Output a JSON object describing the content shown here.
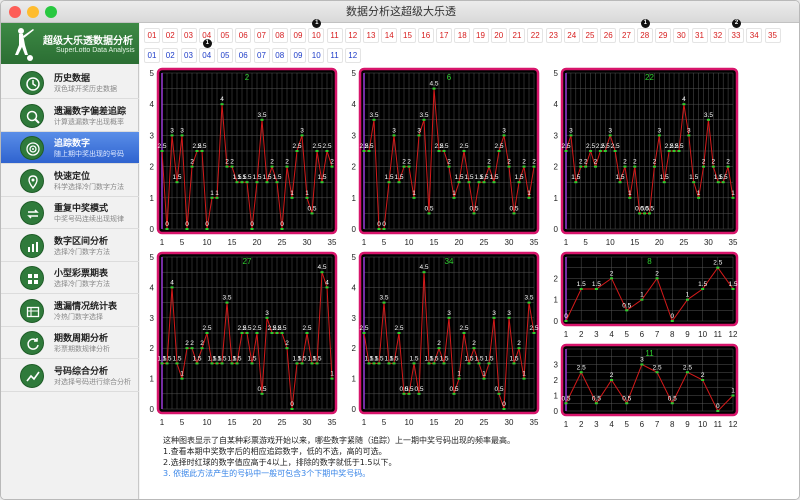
{
  "window": {
    "title": "数据分析这超级大乐透",
    "traffic_colors": [
      "#fd5d57",
      "#febc2e",
      "#28c840"
    ]
  },
  "logo": {
    "title": "超级大乐透数据分析",
    "subtitle": "SuperLotto Data Analysis"
  },
  "nav": [
    {
      "title": "历史数据",
      "subtitle": "双色球开奖历史数据",
      "icon": "clock-icon",
      "active": false
    },
    {
      "title": "遗漏数字偏差追踪",
      "subtitle": "计算遗漏数字出现概率",
      "icon": "magnifier-icon",
      "active": false
    },
    {
      "title": "追踪数字",
      "subtitle": "随上期中奖出现的号码",
      "icon": "target-icon",
      "active": true
    },
    {
      "title": "快速定位",
      "subtitle": "科学选择冷门数字方法",
      "icon": "pin-icon",
      "active": false
    },
    {
      "title": "重复中奖模式",
      "subtitle": "中奖号码连续出现规律",
      "icon": "repeat-icon",
      "active": false
    },
    {
      "title": "数字区间分析",
      "subtitle": "选择冷门数字方法",
      "icon": "chart-bars-icon",
      "active": false
    },
    {
      "title": "小型彩票期表",
      "subtitle": "选择冷门数字方法",
      "icon": "grid-icon",
      "active": false
    },
    {
      "title": "遗漏情况统计表",
      "subtitle": "冷热门数字选择",
      "icon": "table-icon",
      "active": false
    },
    {
      "title": "期数周期分析",
      "subtitle": "彩票期数规律分析",
      "icon": "cycle-icon",
      "active": false
    },
    {
      "title": "号码综合分析",
      "subtitle": "对选择号码进行综合分析",
      "icon": "analysis-icon",
      "active": false
    }
  ],
  "numbers": {
    "red": [
      "01",
      "02",
      "03",
      "04",
      "05",
      "06",
      "07",
      "08",
      "09",
      "10",
      "11",
      "12",
      "13",
      "14",
      "15",
      "16",
      "17",
      "18",
      "19",
      "20",
      "21",
      "22",
      "23",
      "24",
      "25",
      "26",
      "27",
      "28",
      "29",
      "30",
      "31",
      "32",
      "33",
      "34",
      "35"
    ],
    "blue": [
      "01",
      "02",
      "03",
      "04",
      "05",
      "06",
      "07",
      "08",
      "09",
      "10",
      "11",
      "12"
    ],
    "red_badges": [
      {
        "index": 9,
        "label": "1"
      },
      {
        "index": 27,
        "label": "1"
      },
      {
        "index": 32,
        "label": "2"
      }
    ],
    "blue_badges": [
      {
        "index": 3,
        "label": "1"
      }
    ]
  },
  "colors": {
    "chart_bg": "#000000",
    "chart_border": "#d7156b",
    "chart_line": "#d41a1a",
    "chart_label": "#ffffff",
    "chart_title": "#30d030",
    "chart_marker": "#30d030",
    "axis_text": "#222222",
    "red_ball": "#d61d1d",
    "blue_ball": "#1e3ec8"
  },
  "chart_data": [
    {
      "type": "line",
      "title": "2",
      "x": [
        1,
        2,
        3,
        4,
        5,
        6,
        7,
        8,
        9,
        10,
        11,
        12,
        13,
        14,
        15,
        16,
        17,
        18,
        19,
        20,
        21,
        22,
        23,
        24,
        25,
        26,
        27,
        28,
        29,
        30,
        31,
        32,
        33,
        34,
        35
      ],
      "values": [
        2.5,
        0,
        3,
        1.5,
        3,
        0,
        2,
        2.5,
        2.5,
        0,
        1,
        1,
        4,
        2,
        2,
        1.5,
        1.5,
        1.5,
        0,
        1.5,
        3.5,
        1.5,
        2,
        1.5,
        0,
        2,
        1,
        2.5,
        3,
        1,
        0.5,
        2.5,
        1.5,
        2.5,
        2
      ],
      "ylim": [
        0,
        5
      ],
      "xticks": [
        1,
        5,
        10,
        15,
        20,
        25,
        30,
        35
      ],
      "yticks": [
        0,
        1,
        2,
        3,
        4,
        5
      ]
    },
    {
      "type": "line",
      "title": "6",
      "x": [
        1,
        2,
        3,
        4,
        5,
        6,
        7,
        8,
        9,
        10,
        11,
        12,
        13,
        14,
        15,
        16,
        17,
        18,
        19,
        20,
        21,
        22,
        23,
        24,
        25,
        26,
        27,
        28,
        29,
        30,
        31,
        32,
        33,
        34,
        35
      ],
      "values": [
        2.5,
        2.5,
        3.5,
        0,
        0,
        1.5,
        3,
        1.5,
        2,
        2,
        1,
        3,
        3.5,
        0.5,
        4.5,
        2.5,
        2.5,
        2,
        1,
        1.5,
        2.5,
        1.5,
        0.5,
        1.5,
        1.5,
        2,
        1.5,
        2.5,
        3,
        2,
        0.5,
        1.5,
        2,
        1,
        2
      ],
      "ylim": [
        0,
        5
      ],
      "xticks": [
        1,
        5,
        10,
        15,
        20,
        25,
        30,
        35
      ],
      "yticks": [
        0,
        1,
        2,
        3,
        4,
        5
      ]
    },
    {
      "type": "line",
      "title": "22",
      "x": [
        1,
        2,
        3,
        4,
        5,
        6,
        7,
        8,
        9,
        10,
        11,
        12,
        13,
        14,
        15,
        16,
        17,
        18,
        19,
        20,
        21,
        22,
        23,
        24,
        25,
        26,
        27,
        28,
        29,
        30,
        31,
        32,
        33,
        34,
        35
      ],
      "values": [
        2.5,
        3,
        1.5,
        2,
        2,
        2.5,
        2,
        2.5,
        2.5,
        3,
        2.5,
        1.5,
        2,
        1,
        2,
        0.5,
        0.5,
        0.5,
        2,
        3,
        1.5,
        2.5,
        2.5,
        2.5,
        4,
        3,
        1.5,
        1,
        2,
        3.5,
        2,
        1.5,
        1.5,
        2,
        1
      ],
      "ylim": [
        0,
        5
      ],
      "xticks": [
        1,
        5,
        10,
        15,
        20,
        25,
        30,
        35
      ],
      "yticks": [
        0,
        1,
        2,
        3,
        4,
        5
      ]
    },
    {
      "type": "line",
      "title": "27",
      "x": [
        1,
        2,
        3,
        4,
        5,
        6,
        7,
        8,
        9,
        10,
        11,
        12,
        13,
        14,
        15,
        16,
        17,
        18,
        19,
        20,
        21,
        22,
        23,
        24,
        25,
        26,
        27,
        28,
        29,
        30,
        31,
        32,
        33,
        34,
        35
      ],
      "values": [
        1.5,
        1.5,
        4,
        1.5,
        1,
        2,
        2,
        1.5,
        2,
        2.5,
        1.5,
        1.5,
        1.5,
        3.5,
        1.5,
        1.5,
        2.5,
        2.5,
        1.5,
        2.5,
        0.5,
        3,
        2.5,
        2.5,
        2.5,
        2,
        0,
        1.5,
        1.5,
        2.5,
        1.5,
        1.5,
        4.5,
        4,
        1
      ],
      "ylim": [
        0,
        5
      ],
      "xticks": [
        1,
        5,
        10,
        15,
        20,
        25,
        30,
        35
      ],
      "yticks": [
        0,
        1,
        2,
        3,
        4,
        5
      ]
    },
    {
      "type": "line",
      "title": "34",
      "x": [
        1,
        2,
        3,
        4,
        5,
        6,
        7,
        8,
        9,
        10,
        11,
        12,
        13,
        14,
        15,
        16,
        17,
        18,
        19,
        20,
        21,
        22,
        23,
        24,
        25,
        26,
        27,
        28,
        29,
        30,
        31,
        32,
        33,
        34,
        35
      ],
      "values": [
        2.5,
        1.5,
        1.5,
        1.5,
        3.5,
        1.5,
        1.5,
        2.5,
        0.5,
        0.5,
        1.5,
        0.5,
        4.5,
        1.5,
        1.5,
        2,
        1.5,
        3,
        0.5,
        1,
        2.5,
        1.5,
        2,
        1.5,
        1,
        1.5,
        3,
        0.5,
        0,
        3,
        1.5,
        2,
        1,
        3.5,
        2.5
      ],
      "ylim": [
        0,
        5
      ],
      "xticks": [
        1,
        5,
        10,
        15,
        20,
        25,
        30,
        35
      ],
      "yticks": [
        0,
        1,
        2,
        3,
        4,
        5
      ]
    },
    {
      "type": "line",
      "title": "8",
      "x": [
        1,
        2,
        3,
        4,
        5,
        6,
        7,
        8,
        9,
        10,
        11,
        12
      ],
      "values": [
        0,
        1.5,
        1.5,
        2,
        0.5,
        1,
        2,
        0,
        1,
        1.5,
        2.5,
        1.5
      ],
      "ylim": [
        0,
        3
      ],
      "xticks": [
        1,
        2,
        3,
        4,
        5,
        6,
        7,
        8,
        9,
        10,
        11,
        12
      ],
      "yticks": [
        0,
        1,
        2
      ]
    },
    {
      "type": "line",
      "title": "11",
      "x": [
        1,
        2,
        3,
        4,
        5,
        6,
        7,
        8,
        9,
        10,
        11,
        12
      ],
      "values": [
        0.5,
        2.5,
        0.5,
        2,
        0.5,
        3,
        2.5,
        0.5,
        2.5,
        2,
        0,
        1
      ],
      "ylim": [
        0,
        4
      ],
      "xticks": [
        1,
        2,
        3,
        4,
        5,
        6,
        7,
        8,
        9,
        10,
        11,
        12
      ],
      "yticks": [
        0,
        1,
        2,
        3
      ]
    }
  ],
  "notes": {
    "line1": "这种图表显示了自某种彩票游戏开始以来，哪些数字紧随（追踪）上一期中奖号码出现的频率最高。",
    "line2": "1.查看本期中奖数字后的相应追踪数字，低的不选，高的可选。",
    "line3": "2.选择时红球的数字值应高于4以上，排除的数字就低于1.5以下。",
    "line4": "3. 依据此方法产生的号码中一般可包含3个下期中奖号码。"
  }
}
